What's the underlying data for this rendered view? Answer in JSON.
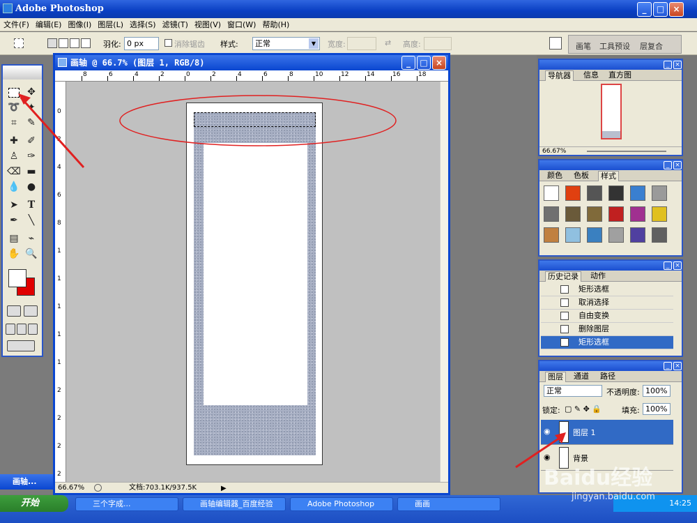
{
  "app": {
    "title": "Adobe Photoshop"
  },
  "menu": [
    "文件(F)",
    "编辑(E)",
    "图像(I)",
    "图层(L)",
    "选择(S)",
    "滤镜(T)",
    "视图(V)",
    "窗口(W)",
    "帮助(H)"
  ],
  "options": {
    "feather_label": "羽化:",
    "feather_value": "0 px",
    "antialias_label": "消除锯齿",
    "style_label": "样式:",
    "style_value": "正常",
    "width_label": "宽度:",
    "height_label": "高度:"
  },
  "palette_well": {
    "tabs": [
      "画笔",
      "工具预设",
      "层复合"
    ]
  },
  "document": {
    "title": "画轴 @ 66.7% (图层 1, RGB/8)",
    "zoom": "66.67%",
    "doc_info": "文档:703.1K/937.5K",
    "ruler_h_labels": [
      "8",
      "6",
      "4",
      "2",
      "0",
      "2",
      "4",
      "6",
      "8",
      "10",
      "12",
      "14",
      "16",
      "18"
    ],
    "ruler_v_labels": [
      "0",
      "2",
      "4",
      "6",
      "8",
      "1",
      "1",
      "1",
      "1",
      "1",
      "2",
      "2",
      "2",
      "2"
    ]
  },
  "navigator": {
    "tabs": [
      "导航器",
      "信息",
      "直方图"
    ],
    "zoom": "66.67%"
  },
  "styles_panel": {
    "tabs": [
      "颜色",
      "色板",
      "样式"
    ],
    "swatches": [
      "#ffffff",
      "#e04010",
      "#555555",
      "#333333",
      "#3a7fd0",
      "#9a9a9a",
      "#707070",
      "#6a5a3a",
      "#806a3a",
      "#c02020",
      "#a03090",
      "#e0c020",
      "#c08040",
      "#90c0e0",
      "#3a80c0",
      "#a0a0a0",
      "#5040a0",
      "#606060"
    ]
  },
  "history": {
    "tabs": [
      "历史记录",
      "动作"
    ],
    "items": [
      "矩形选框",
      "取消选择",
      "自由变换",
      "删除图层",
      "矩形选框"
    ],
    "selected_index": 4
  },
  "layers": {
    "tabs": [
      "图层",
      "通道",
      "路径"
    ],
    "blend_mode": "正常",
    "opacity_label": "不透明度:",
    "opacity": "100%",
    "lock_label": "锁定:",
    "fill_label": "填充:",
    "fill": "100%",
    "items": [
      {
        "name": "图层 1",
        "selected": true
      },
      {
        "name": "背景",
        "selected": false
      }
    ]
  },
  "minimized_doc": {
    "label": "画轴..."
  },
  "taskbar": {
    "start": "开始",
    "buttons": [
      "三个字成...",
      "画轴编辑器_百度经验",
      "Adobe Photoshop",
      "画画"
    ],
    "clock": "14:25"
  },
  "watermark": {
    "line1": "Baidu经验",
    "line2": "jingyan.baidu.com"
  },
  "colors": {
    "title_blue": "#0a46d0",
    "accent_select": "#316ac5",
    "annotation_red": "#e02020",
    "bg_color": "#e00000"
  }
}
